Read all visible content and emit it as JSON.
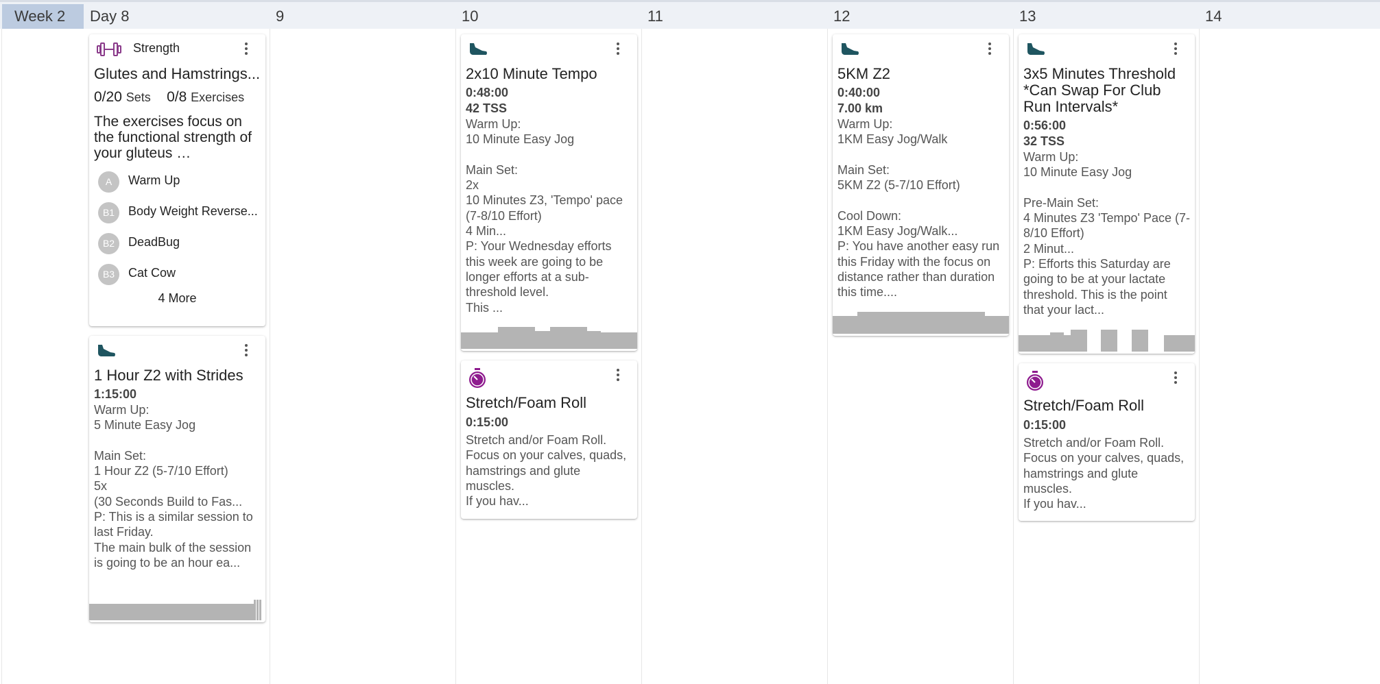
{
  "header": {
    "week_label": "Week 2",
    "day_labels": [
      "Day 8",
      "9",
      "10",
      "11",
      "12",
      "13",
      "14"
    ]
  },
  "cards": {
    "strength": {
      "type_label": "Strength",
      "icon": "dumbbell-icon",
      "title": "Glutes and Hamstrings...",
      "sets_done": "0/20",
      "sets_label": "Sets",
      "ex_done": "0/8",
      "ex_label": "Exercises",
      "description": "The exercises focus on the functional strength of your gluteus …",
      "exercises": [
        {
          "badge": "A",
          "name": "Warm Up"
        },
        {
          "badge": "B1",
          "name": "Body Weight Reverse..."
        },
        {
          "badge": "B2",
          "name": "DeadBug"
        },
        {
          "badge": "B3",
          "name": "Cat Cow"
        }
      ],
      "more_label": "4 More"
    },
    "run_day8": {
      "icon": "running-shoe-icon",
      "title": "1 Hour Z2 with Strides",
      "duration": "1:15:00",
      "description": "Warm Up:\n5 Minute Easy Jog\n\nMain Set:\n1 Hour Z2 (5-7/10 Effort)\n5x\n(30 Seconds Build to Fas...\nP: This is a similar session to last Friday.\nThe main bulk of the session is going to be an hour ea..."
    },
    "run_day10": {
      "icon": "running-shoe-icon",
      "title": "2x10 Minute Tempo",
      "duration": "0:48:00",
      "tss": "42 TSS",
      "description": "Warm Up:\n10 Minute Easy Jog\n\nMain Set:\n2x\n10 Minutes Z3, 'Tempo' pace (7-8/10 Effort)\n4 Min...\nP: Your Wednesday efforts this week are going to be longer efforts at a sub-threshold level.\nThis ..."
    },
    "stretch_day10": {
      "icon": "stopwatch-icon",
      "title": "Stretch/Foam Roll",
      "duration": "0:15:00",
      "description": "Stretch and/or Foam Roll. Focus on your calves, quads, hamstrings and glute muscles.\nIf you hav..."
    },
    "run_day12": {
      "icon": "running-shoe-icon",
      "title": "5KM Z2",
      "duration": "0:40:00",
      "distance": "7.00 km",
      "description": "Warm Up:\n1KM Easy Jog/Walk\n\nMain Set:\n5KM Z2 (5-7/10 Effort)\n\nCool Down:\n1KM Easy Jog/Walk...\nP: You have another easy run this Friday with the focus on distance rather than duration this time...."
    },
    "run_day13": {
      "icon": "running-shoe-icon",
      "title": "3x5 Minutes Threshold *Can Swap For Club Run Intervals*",
      "duration": "0:56:00",
      "tss": "32 TSS",
      "description": "Warm Up:\n10 Minute Easy Jog\n\nPre-Main Set:\n4 Minutes Z3 'Tempo' Pace (7-8/10 Effort)\n2 Minut...\nP: Efforts this Saturday are going to be at your lactate threshold. This is the point that your lact..."
    },
    "stretch_day13": {
      "icon": "stopwatch-icon",
      "title": "Stretch/Foam Roll",
      "duration": "0:15:00",
      "description": "Stretch and/or Foam Roll. Focus on your calves, quads, hamstrings and glute muscles.\nIf you hav..."
    }
  },
  "colors": {
    "shoe_icon": "#1f5560",
    "stopwatch_icon": "#8e1b8e",
    "dumbbell_icon": "#8a3a8a",
    "bar_gray": "#b4b4b4",
    "week_cell": "#bccbe0"
  }
}
